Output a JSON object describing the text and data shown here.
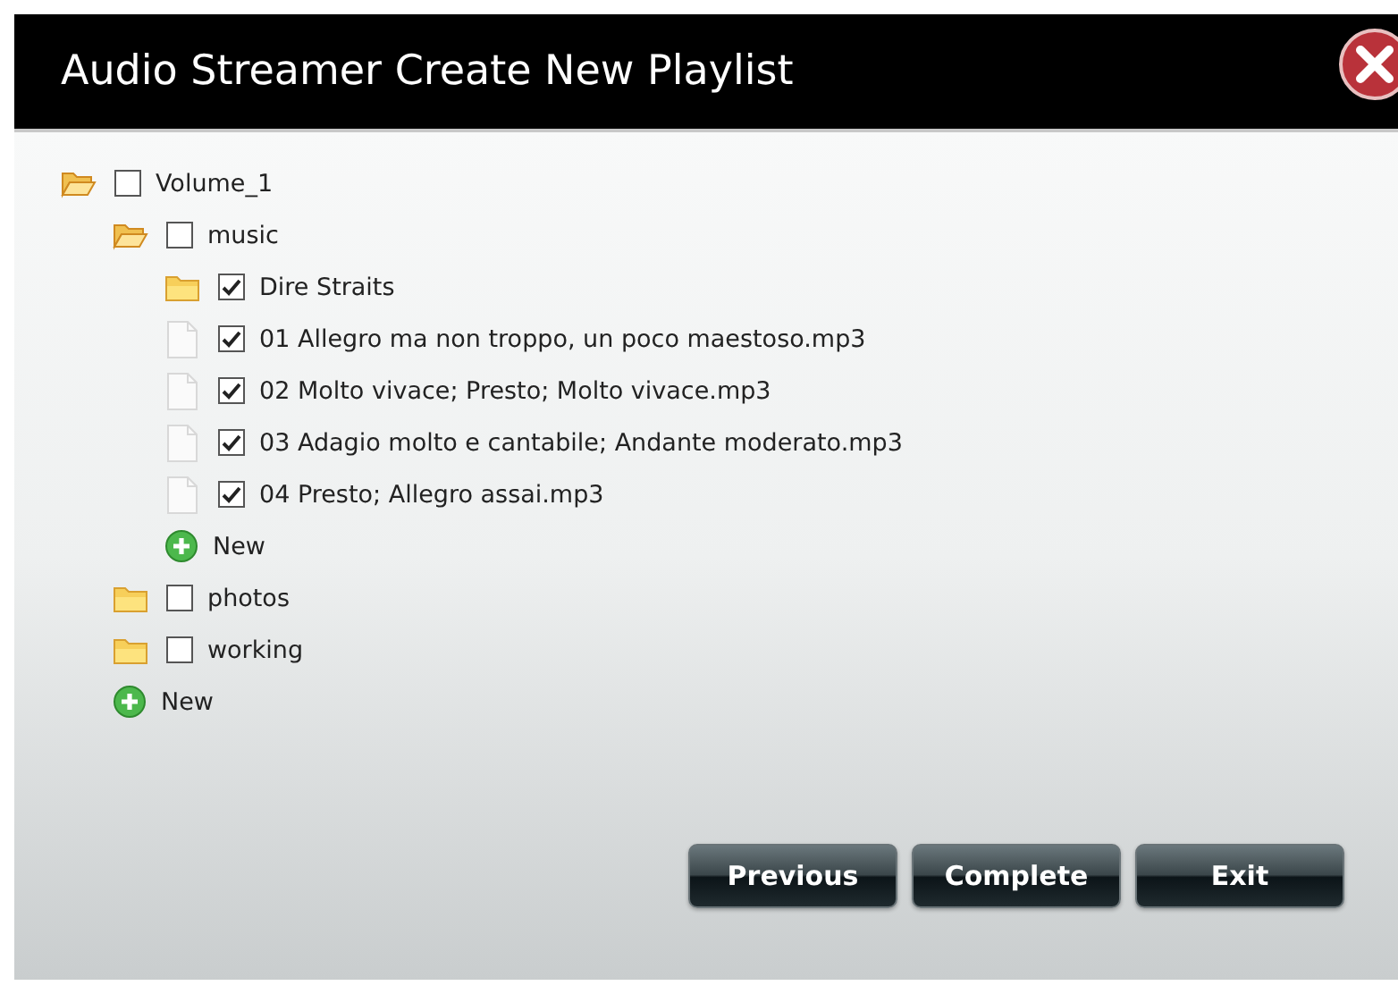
{
  "window": {
    "title": "Audio Streamer Create New Playlist"
  },
  "tree": [
    {
      "kind": "folder",
      "label": "Volume_1",
      "checked": false,
      "expanded": true,
      "children": [
        {
          "kind": "folder",
          "label": "music",
          "checked": false,
          "expanded": true,
          "children": [
            {
              "kind": "folder",
              "label": "Dire Straits",
              "checked": true,
              "expanded": false
            },
            {
              "kind": "file",
              "label": "01 Allegro ma non troppo, un poco maestoso.mp3",
              "checked": true
            },
            {
              "kind": "file",
              "label": "02 Molto vivace; Presto; Molto vivace.mp3",
              "checked": true
            },
            {
              "kind": "file",
              "label": "03 Adagio molto e cantabile; Andante moderato.mp3",
              "checked": true
            },
            {
              "kind": "file",
              "label": "04 Presto; Allegro assai.mp3",
              "checked": true
            },
            {
              "kind": "new",
              "label": "New"
            }
          ]
        },
        {
          "kind": "folder",
          "label": "photos",
          "checked": false,
          "expanded": false
        },
        {
          "kind": "folder",
          "label": "working",
          "checked": false,
          "expanded": false
        },
        {
          "kind": "new",
          "label": "New"
        }
      ]
    }
  ],
  "buttons": [
    "Previous",
    "Complete",
    "Exit"
  ]
}
